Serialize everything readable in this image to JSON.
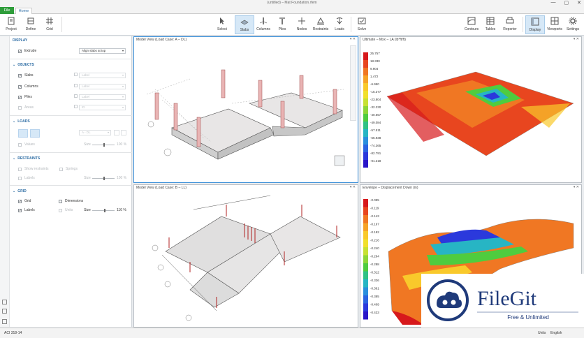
{
  "window": {
    "title": "(untitled) – Mat Foundation.rfem",
    "min": "—",
    "max": "▢",
    "close": "✕"
  },
  "tabs": {
    "file": "File",
    "home": "Home"
  },
  "ribbon": {
    "project": "Project",
    "define": "Define",
    "grid": "Grid",
    "select": "Select",
    "slabs": "Slabs",
    "columns": "Columns",
    "piles": "Piles",
    "nodes": "Nodes",
    "restraints": "Restraints",
    "loads": "Loads",
    "solve": "Solve",
    "contours": "Contours",
    "tables": "Tables",
    "reporter": "Reporter",
    "display": "Display",
    "viewports": "Viewports",
    "settings": "Settings"
  },
  "panel": {
    "display": {
      "header": "DISPLAY",
      "extrude": "Extrude",
      "extrude_value": "Align slabs at top"
    },
    "objects": {
      "header": "OBJECTS",
      "slabs": "Slabs",
      "columns": "Columns",
      "piles": "Piles",
      "areas": "Areas",
      "slabs_dd": "Label",
      "columns_dd": "Label",
      "piles_dd": "Label",
      "areas_dd": "ID"
    },
    "loads": {
      "header": "LOADS",
      "loadcase": "A - DL",
      "values": "Values",
      "size": "Size",
      "size_pct": "100 %"
    },
    "restraints": {
      "header": "RESTRAINTS",
      "show_labels": "Show restraints",
      "springs": "Springs",
      "labels": "Labels",
      "size": "Size",
      "size_pct": "100 %"
    },
    "grid": {
      "header": "GRID",
      "grid": "Grid",
      "dimensions": "Dimensions",
      "labels": "Labels",
      "units": "Units",
      "size": "Size",
      "size_pct": "110 %"
    }
  },
  "viewports": {
    "v1": {
      "title": "Model View (Load Case: A – DL)"
    },
    "v2": {
      "title": "Ultimate – Mxx – LA (lb*ft/ft)"
    },
    "v3": {
      "title": "Model View (Load Case: B – LL)"
    },
    "v4": {
      "title": "Envelope – Displacement Down (in)"
    }
  },
  "legend_top": [
    "25.757",
    "18.330",
    "9.904",
    "1.472",
    "-6.950",
    "-15.377",
    "-23.804",
    "-32.230",
    "-40.657",
    "-49.084",
    "-57.511",
    "-65.938",
    "-74.365",
    "-82.791",
    "-91.218"
  ],
  "legend_bottom": [
    "-0.095",
    "-0.119",
    "-0.143",
    "-0.167",
    "-0.192",
    "-0.216",
    "-0.240",
    "-0.264",
    "-0.288",
    "-0.312",
    "-0.336",
    "-0.361",
    "-0.385",
    "-0.409",
    "-0.433"
  ],
  "legend_colors": [
    "#d7191c",
    "#e8461f",
    "#f07723",
    "#f6a328",
    "#f9c92b",
    "#f1e02c",
    "#c7e133",
    "#8dd638",
    "#4fcc3f",
    "#2fc285",
    "#27b5c4",
    "#2a8fdd",
    "#2b64e1",
    "#2b39dc",
    "#2a16c9"
  ],
  "status": {
    "code": "ACI 318-14",
    "units": "Units",
    "units_value": "English"
  },
  "watermark": {
    "brand": "FileGit",
    "tagline": "Free & Unlimited"
  }
}
